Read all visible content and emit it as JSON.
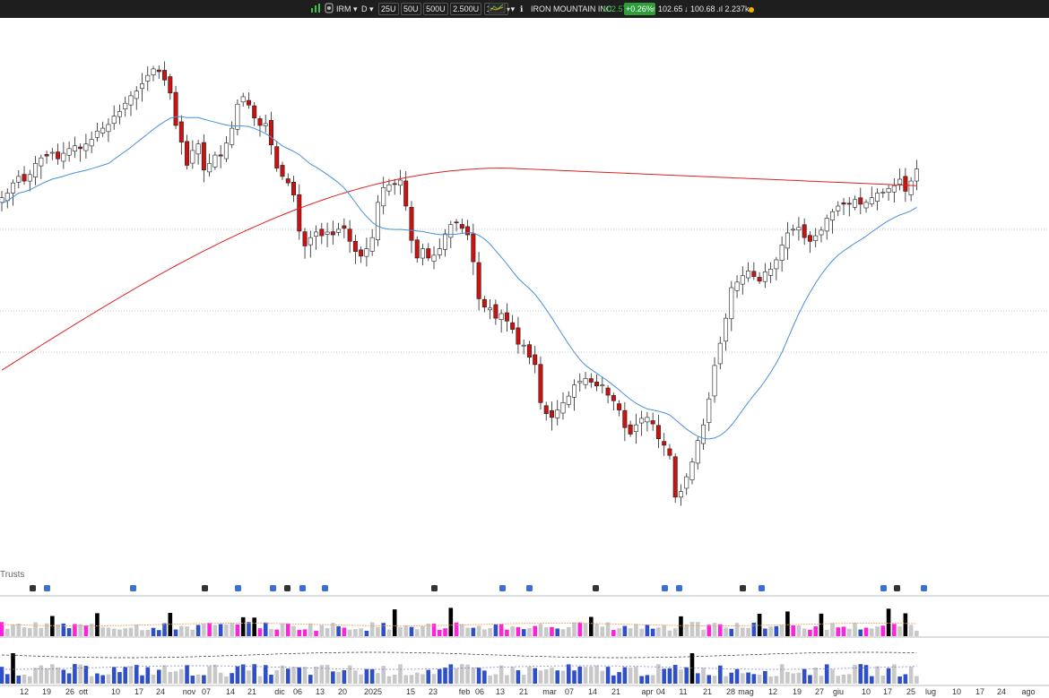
{
  "toolbar": {
    "symbol": "IRM",
    "interval": "D",
    "size_buttons": [
      "25U",
      "50U",
      "500U",
      "2.500U",
      "100U"
    ],
    "company": "IRON MOUNTAIN INC.",
    "last_price": "102.57",
    "change_pct": "+0.26%",
    "high_label": "↑ 102.65",
    "low_label": "↓ 100.68",
    "volume_label": ".ıl 2.237k",
    "info_icon": "info-icon",
    "chart_icon": "bar-chart-icon",
    "indicator_icon": "indicator-icon",
    "colors": {
      "bar_bg": "#1e1e1e",
      "up": "#39c24b",
      "dot": "#f0b400"
    }
  },
  "panel_label": "Trusts",
  "chart_data": {
    "type": "candlestick",
    "colors": {
      "up": "#ffffff",
      "down": "#cc1111",
      "ma_short": "#4a90d9",
      "ma_long": "#e02020",
      "vol_black": "#000000",
      "vol_blue": "#2f4fc8",
      "vol_gray": "#c8c8c8",
      "vol_magenta": "#ff22dd"
    },
    "x_ticks": [
      "12",
      "19",
      "26",
      "ott",
      "10",
      "17",
      "24",
      "nov",
      "07",
      "14",
      "21",
      "dic",
      "06",
      "13",
      "20",
      "2025",
      "15",
      "23",
      "feb",
      "06",
      "13",
      "21",
      "mar",
      "07",
      "14",
      "21",
      "apr",
      "04",
      "11",
      "21",
      "28",
      "mag",
      "12",
      "19",
      "27",
      "giu",
      "10",
      "17",
      "25",
      "lug",
      "10",
      "17",
      "24",
      "ago"
    ],
    "closes": [
      98.6,
      99.1,
      100.2,
      100.9,
      100.4,
      101.1,
      102.3,
      102.9,
      103.1,
      103.5,
      102.8,
      103.4,
      103.9,
      104.2,
      103.9,
      104.4,
      104.9,
      105.8,
      106.1,
      106.5,
      107.4,
      107.9,
      108.8,
      109.6,
      110.1,
      110.9,
      111.8,
      112.5,
      112.2,
      111.3,
      109.9,
      106.4,
      104.6,
      102.1,
      103.7,
      104.4,
      101.6,
      102.3,
      103.2,
      103.1,
      104.5,
      106.1,
      108.7,
      109.5,
      108.6,
      107.2,
      106.4,
      106.6,
      104.3,
      101.8,
      100.9,
      100.2,
      98.9,
      95.0,
      93.4,
      94.3,
      94.9,
      94.5,
      94.9,
      94.6,
      95.2,
      95.3,
      93.9,
      92.8,
      92.3,
      93.1,
      94.3,
      98.1,
      99.7,
      100.0,
      100.1,
      100.5,
      97.7,
      94.0,
      92.1,
      93.1,
      92.1,
      92.4,
      93.1,
      94.7,
      95.7,
      95.9,
      95.3,
      94.6,
      91.7,
      87.7,
      86.8,
      86.7,
      85.6,
      86.1,
      85.3,
      84.4,
      82.8,
      82.7,
      81.4,
      80.6,
      76.5,
      75.3,
      74.9,
      75.7,
      76.5,
      77.2,
      78.4,
      78.8,
      79.1,
      78.7,
      78.3,
      78.4,
      77.3,
      76.7,
      75.7,
      73.8,
      73.1,
      74.1,
      74.8,
      74.9,
      74.2,
      72.6,
      71.9,
      70.8,
      66.3,
      66.9,
      68.5,
      70.1,
      72.4,
      74.1,
      76.9,
      80.5,
      82.9,
      85.6,
      88.9,
      89.5,
      90.2,
      90.7,
      90.1,
      89.6,
      90.6,
      90.9,
      91.9,
      93.5,
      94.8,
      95.2,
      95.4,
      94.3,
      93.9,
      94.5,
      95.1,
      96.4,
      97.1,
      97.7,
      97.9,
      97.9,
      98.4,
      97.9,
      98.1,
      98.6,
      99.1,
      99.2,
      99.6,
      99.9,
      100.6,
      99.3,
      100.4,
      101.7
    ],
    "ma_short_name": "",
    "ma_long_name": "",
    "price_range": [
      60,
      118
    ]
  }
}
